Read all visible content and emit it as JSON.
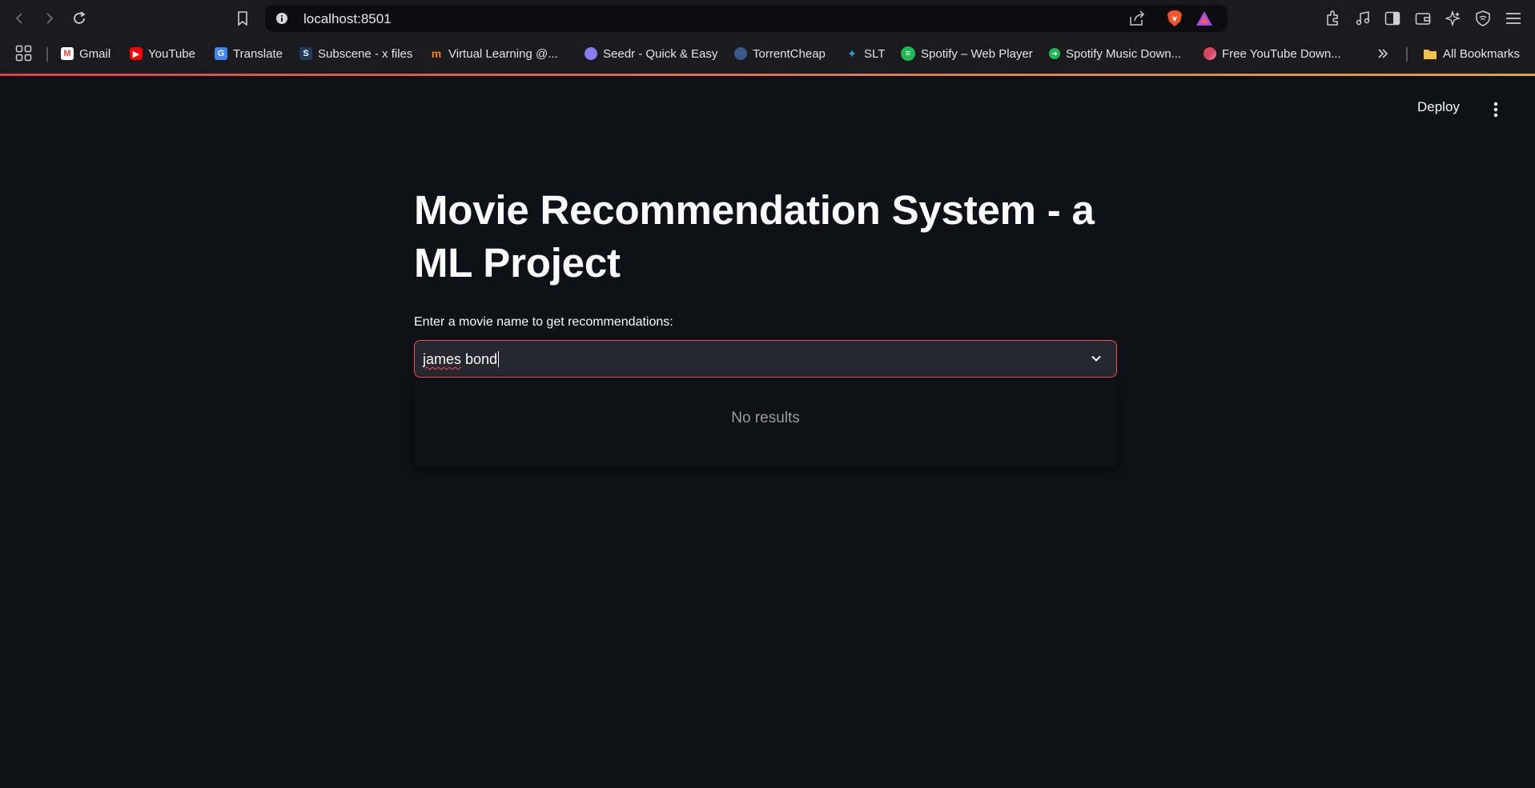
{
  "browser": {
    "url": "localhost:8501",
    "bookmarks": [
      {
        "label": "Gmail",
        "icon": "gmail-icon",
        "color": "#ea4335"
      },
      {
        "label": "YouTube",
        "icon": "youtube-icon",
        "color": "#ff0000"
      },
      {
        "label": "Translate",
        "icon": "translate-icon",
        "color": "#4285f4"
      },
      {
        "label": "Subscene - x files",
        "icon": "subscene-icon",
        "color": "#1f3a5f"
      },
      {
        "label": "Virtual Learning @...",
        "icon": "moodle-icon",
        "color": "#f98012"
      },
      {
        "label": "Seedr - Quick & Easy",
        "icon": "seedr-icon",
        "color": "#8a7cf0"
      },
      {
        "label": "TorrentCheap",
        "icon": "torrentcheap-icon",
        "color": "#3a5a8a"
      },
      {
        "label": "SLT",
        "icon": "slt-icon",
        "color": "#2aa0d8"
      },
      {
        "label": "Spotify – Web Player",
        "icon": "spotify-icon",
        "color": "#1db954"
      },
      {
        "label": "Spotify Music Down...",
        "icon": "spotify-downloader-icon",
        "color": "#1db954"
      },
      {
        "label": "Free YouTube Down...",
        "icon": "youtube-downloader-icon",
        "color": "#e0533b"
      }
    ],
    "all_bookmarks_label": "All Bookmarks"
  },
  "app": {
    "deploy_label": "Deploy",
    "title": "Movie Recommendation System - a ML Project",
    "input_label": "Enter a movie name to get recommendations:",
    "select_value_first": "james",
    "select_value_rest": " bond",
    "dropdown_message": "No results"
  },
  "colors": {
    "background": "#0e1117",
    "accent": "#ff4b4b",
    "input_bg": "#262730"
  }
}
